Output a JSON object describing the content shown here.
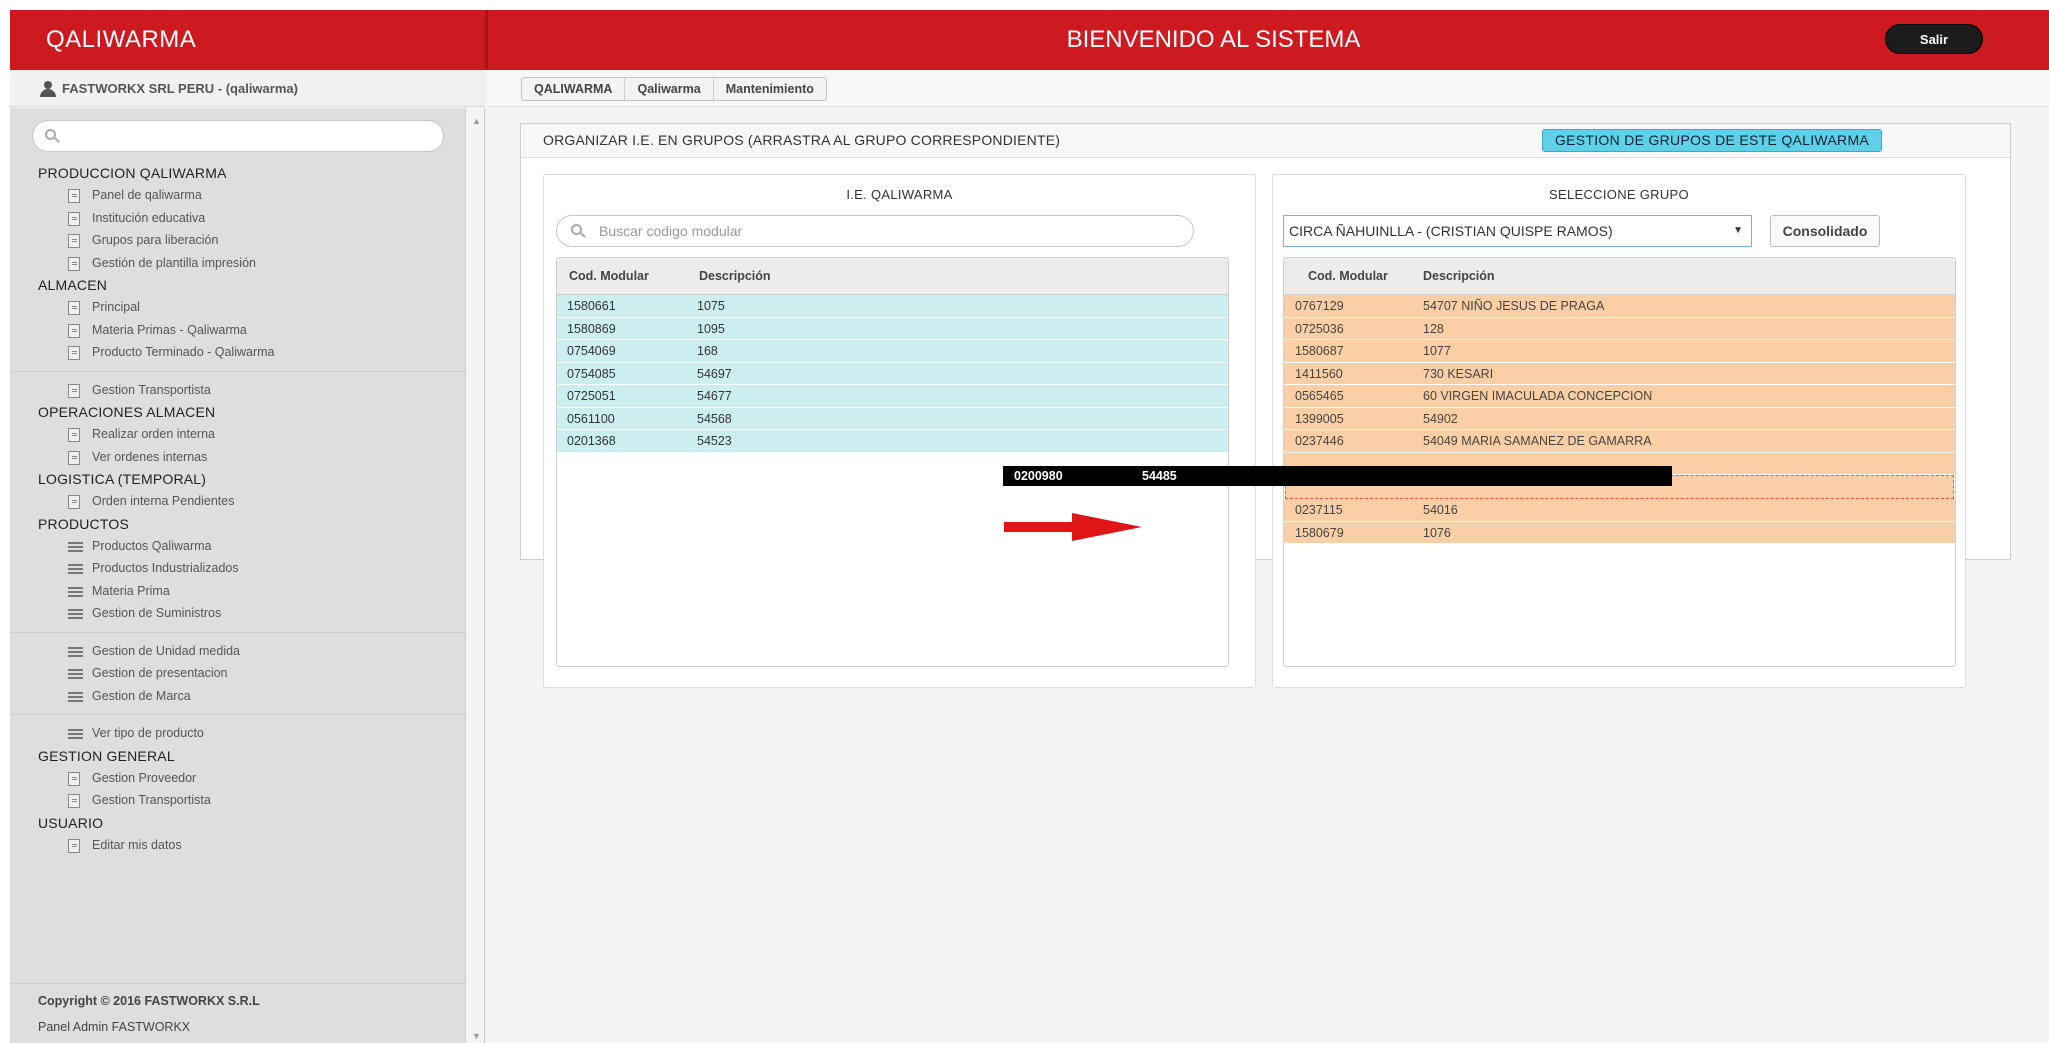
{
  "header": {
    "brand": "QALIWARMA",
    "welcome": "BIENVENIDO AL SISTEMA",
    "logout": "Salir"
  },
  "user": {
    "label": "FASTWORKX SRL PERU - (qaliwarma)"
  },
  "breadcrumb": [
    "QALIWARMA",
    "Qaliwarma",
    "Mantenimiento"
  ],
  "sidebar": {
    "search_placeholder": "",
    "groups": [
      {
        "title": "PRODUCCION QALIWARMA",
        "items": [
          {
            "label": "Panel de qaliwarma",
            "icon": "document-icon"
          },
          {
            "label": "Institución educativa",
            "icon": "document-icon"
          },
          {
            "label": "Grupos para liberación",
            "icon": "document-icon"
          },
          {
            "label": "Gestión de plantilla impresión",
            "icon": "document-icon"
          }
        ]
      },
      {
        "title": "ALMACEN",
        "items": [
          {
            "label": "Principal",
            "icon": "document-icon"
          },
          {
            "label": "Materia Primas - Qaliwarma",
            "icon": "document-icon"
          },
          {
            "label": "Producto Terminado - Qaliwarma",
            "icon": "document-icon"
          },
          {
            "divider": true
          },
          {
            "label": "Gestion Transportista",
            "icon": "document-icon"
          }
        ]
      },
      {
        "title": "OPERACIONES ALMACEN",
        "items": [
          {
            "label": "Realizar orden interna",
            "icon": "document-icon"
          },
          {
            "label": "Ver ordenes internas",
            "icon": "document-icon"
          }
        ]
      },
      {
        "title": "LOGISTICA (TEMPORAL)",
        "items": [
          {
            "label": "Orden interna Pendientes",
            "icon": "document-icon"
          }
        ]
      },
      {
        "title": "PRODUCTOS",
        "items": [
          {
            "label": "Productos Qaliwarma",
            "icon": "list-icon"
          },
          {
            "label": "Productos Industrializados",
            "icon": "list-icon"
          },
          {
            "label": "Materia Prima",
            "icon": "list-icon"
          },
          {
            "label": "Gestion de Suministros",
            "icon": "list-icon"
          },
          {
            "divider": true
          },
          {
            "label": "Gestion de Unidad medida",
            "icon": "list-icon"
          },
          {
            "label": "Gestion de presentacion",
            "icon": "list-icon"
          },
          {
            "label": "Gestion de Marca",
            "icon": "list-icon"
          },
          {
            "divider": true
          },
          {
            "label": "Ver tipo de producto",
            "icon": "list-icon"
          }
        ]
      },
      {
        "title": "GESTION GENERAL",
        "items": [
          {
            "label": "Gestion Proveedor",
            "icon": "document-icon"
          },
          {
            "label": "Gestion Transportista",
            "icon": "document-icon"
          }
        ]
      },
      {
        "title": "USUARIO",
        "items": [
          {
            "label": "Editar mis datos",
            "icon": "document-icon"
          }
        ]
      }
    ],
    "footer": {
      "copyright": "Copyright © 2016 FASTWORKX S.R.L",
      "admin": "Panel Admin FASTWORKX"
    }
  },
  "panel": {
    "title": "ORGANIZAR I.E. EN GRUPOS (ARRASTRA AL GRUPO CORRESPONDIENTE)",
    "groups_button": "GESTION DE GRUPOS DE ESTE QALIWARMA"
  },
  "left_box": {
    "title": "I.E. QALIWARMA",
    "search_placeholder": "Buscar codigo modular",
    "columns": [
      "Cod. Modular",
      "Descripción"
    ],
    "rows": [
      [
        "1580661",
        "1075"
      ],
      [
        "1580869",
        "1095"
      ],
      [
        "0754069",
        "168"
      ],
      [
        "0754085",
        "54697"
      ],
      [
        "0725051",
        "54677"
      ],
      [
        "0561100",
        "54568"
      ],
      [
        "0201368",
        "54523"
      ]
    ]
  },
  "dragging_row": [
    "0200980",
    "54485"
  ],
  "right_box": {
    "title": "SELECCIONE GRUPO",
    "selected_group": "CIRCA ÑAHUINLLA - (CRISTIAN QUISPE RAMOS)",
    "consolidated_button": "Consolidado",
    "columns": [
      "Cod. Modular",
      "Descripción"
    ],
    "rows_before": [
      [
        "0767129",
        "54707 NIÑO JESUS DE PRAGA"
      ],
      [
        "0725036",
        "128"
      ],
      [
        "1580687",
        "1077"
      ],
      [
        "1411560",
        "730 KESARI"
      ],
      [
        "0565465",
        "60 VIRGEN IMACULADA CONCEPCION"
      ],
      [
        "1399005",
        "54902"
      ],
      [
        "0237446",
        "54049 MARIA SAMANEZ DE GAMARRA"
      ]
    ],
    "rows_after": [
      [
        "0237115",
        "54016"
      ],
      [
        "1580679",
        "1076"
      ]
    ]
  },
  "colors": {
    "header_red": "#cd1a20",
    "left_rows": "#cdeef0",
    "right_rows": "#fbcfa6",
    "groups_button": "#5ed0e8"
  }
}
